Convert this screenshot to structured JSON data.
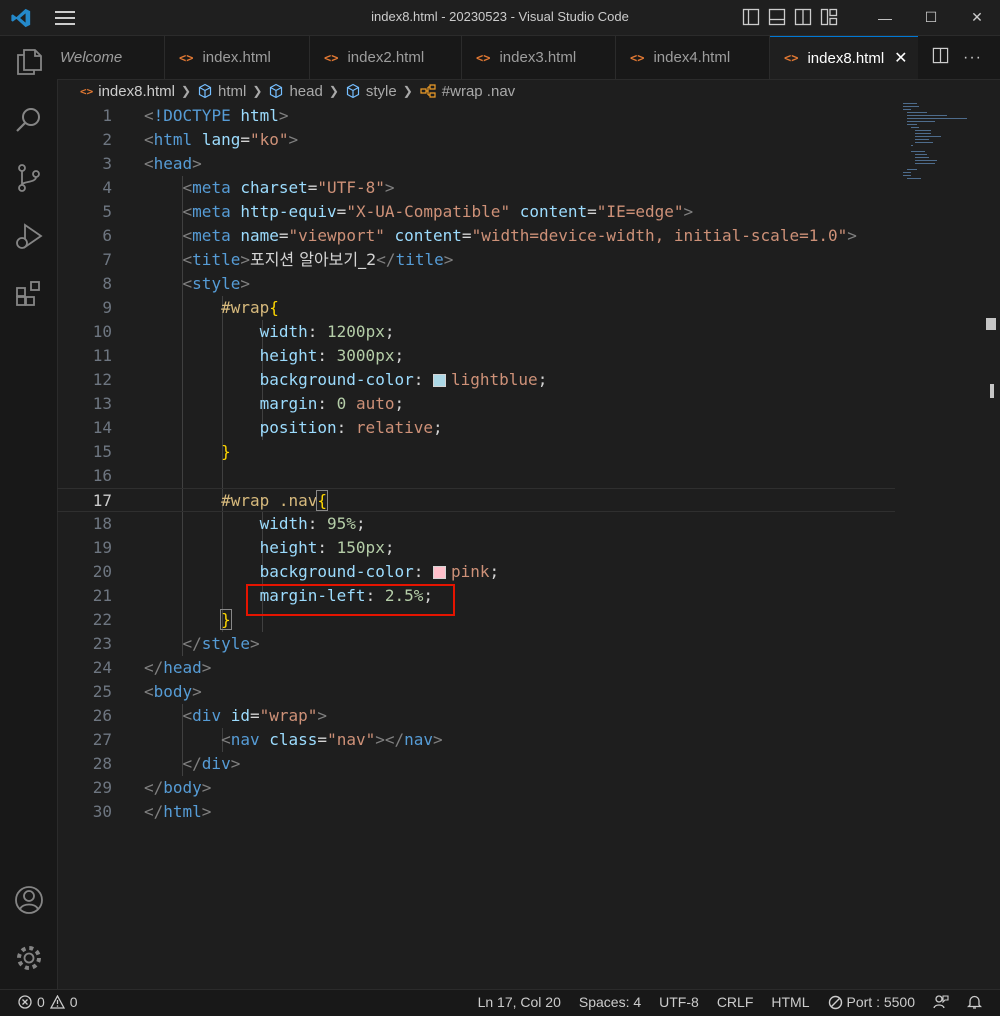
{
  "window": {
    "title": "index8.html - 20230523 - Visual Studio Code"
  },
  "tabs": [
    {
      "label": "Welcome",
      "active": false
    },
    {
      "label": "index.html",
      "active": false
    },
    {
      "label": "index2.html",
      "active": false
    },
    {
      "label": "index3.html",
      "active": false
    },
    {
      "label": "index4.html",
      "active": false
    },
    {
      "label": "index8.html",
      "active": true
    }
  ],
  "breadcrumb": [
    "index8.html",
    "html",
    "head",
    "style",
    "#wrap .nav"
  ],
  "editor": {
    "current_line": 17,
    "lines": [
      {
        "n": "1"
      },
      {
        "n": "2"
      },
      {
        "n": "3"
      },
      {
        "n": "4"
      },
      {
        "n": "5"
      },
      {
        "n": "6"
      },
      {
        "n": "7"
      },
      {
        "n": "8"
      },
      {
        "n": "9"
      },
      {
        "n": "10"
      },
      {
        "n": "11"
      },
      {
        "n": "12"
      },
      {
        "n": "13"
      },
      {
        "n": "14"
      },
      {
        "n": "15"
      },
      {
        "n": "16"
      },
      {
        "n": "17"
      },
      {
        "n": "18"
      },
      {
        "n": "19"
      },
      {
        "n": "20"
      },
      {
        "n": "21"
      },
      {
        "n": "22"
      },
      {
        "n": "23"
      },
      {
        "n": "24"
      },
      {
        "n": "25"
      },
      {
        "n": "26"
      },
      {
        "n": "27"
      },
      {
        "n": "28"
      },
      {
        "n": "29"
      },
      {
        "n": "30"
      }
    ],
    "tokens": {
      "doctype_kw": "!DOCTYPE",
      "doctype_val": "html",
      "html": "html",
      "lang_attr": "lang",
      "lang_val": "\"ko\"",
      "head": "head",
      "meta": "meta",
      "charset_attr": "charset",
      "charset_val": "\"UTF-8\"",
      "http_equiv_attr": "http-equiv",
      "http_equiv_val": "\"X-UA-Compatible\"",
      "content_attr": "content",
      "content_val1": "\"IE=edge\"",
      "name_attr": "name",
      "name_val": "\"viewport\"",
      "content_val2": "\"width=device-width, initial-scale=1.0\"",
      "title": "title",
      "title_text": "포지션 알아보기_2",
      "style": "style",
      "sel_wrap": "#wrap",
      "sel_wrap_nav": "#wrap .nav",
      "open_brace": "{",
      "close_brace": "}",
      "p_width": "width",
      "v_width1": "1200px",
      "p_height": "height",
      "v_height1": "3000px",
      "p_bg": "background-color",
      "v_bg1": "lightblue",
      "p_margin": "margin",
      "v_margin_num": "0",
      "v_margin_auto": "auto",
      "p_position": "position",
      "v_position": "relative",
      "v_width2": "95%",
      "v_height2": "150px",
      "v_bg2": "pink",
      "p_margin_left": "margin-left",
      "v_margin_left": "2.5%",
      "body": "body",
      "div": "div",
      "id_attr": "id",
      "id_val": "\"wrap\"",
      "nav": "nav",
      "class_attr": "class",
      "class_val": "\"nav\""
    },
    "colors": {
      "lightblue_swatch": "#add8e6",
      "pink_swatch": "#ffc0cb",
      "highlight_box": "#e51400"
    }
  },
  "statusbar": {
    "errors": "0",
    "warnings": "0",
    "position": "Ln 17, Col 20",
    "spaces": "Spaces: 4",
    "encoding": "UTF-8",
    "eol": "CRLF",
    "language": "HTML",
    "port": "Port : 5500"
  }
}
